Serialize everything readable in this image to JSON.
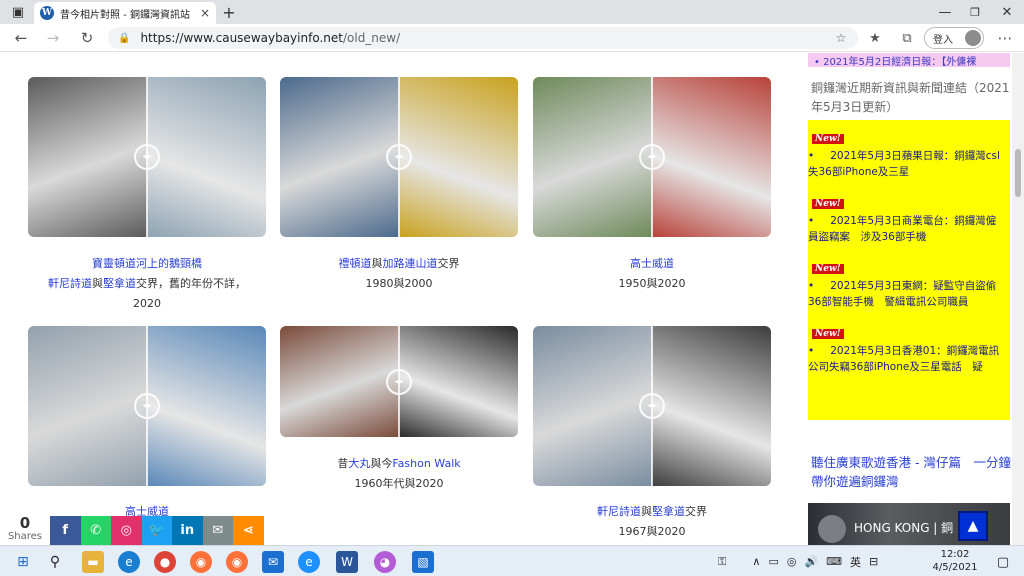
{
  "browser": {
    "tab_title": "昔今相片對照 - 銅鑼灣資訊站",
    "tab_close": "×",
    "new_tab": "+",
    "url_host": "https://www.causewaybayinfo.net",
    "url_path": "/old_new/",
    "login_label": "登入",
    "window_controls": [
      "—",
      "❐",
      "✕"
    ]
  },
  "sliders": [
    {
      "caption_lines": [
        [
          {
            "text": "寶靈頓道河上的鵝頸橋",
            "link": true
          }
        ],
        [
          {
            "text": "軒尼詩道",
            "link": true
          },
          {
            "text": "與",
            "link": false
          },
          {
            "text": "堅拿道",
            "link": true
          },
          {
            "text": "交界，舊的年份不詳，",
            "link": false
          }
        ],
        [
          {
            "text": "2020",
            "link": false
          }
        ]
      ],
      "old_color": "#5b5b5b",
      "new_color": "#8da3b3",
      "split": 0.5
    },
    {
      "caption_lines": [
        [
          {
            "text": "禮頓道",
            "link": true
          },
          {
            "text": "與",
            "link": false
          },
          {
            "text": "加路連山道",
            "link": true
          },
          {
            "text": "交界",
            "link": false
          }
        ],
        [
          {
            "text": "1980與2000",
            "link": false
          }
        ]
      ],
      "old_color": "#4c6a8c",
      "new_color": "#c9a21e",
      "split": 0.5
    },
    {
      "caption_lines": [
        [
          {
            "text": "高士威道",
            "link": true
          }
        ],
        [
          {
            "text": "1950與2020",
            "link": false
          }
        ]
      ],
      "old_color": "#6e8a5a",
      "new_color": "#b8423a",
      "split": 0.5
    },
    {
      "caption_lines": [
        [
          {
            "text": "高士威道",
            "link": true
          }
        ]
      ],
      "old_color": "#93a1ad",
      "new_color": "#5a88b8",
      "split": 0.5
    },
    {
      "caption_lines": [
        [
          {
            "text": "昔",
            "link": false
          },
          {
            "text": "大丸",
            "link": true
          },
          {
            "text": "與今",
            "link": false
          },
          {
            "text": "Fashon Walk",
            "link": true
          }
        ],
        [
          {
            "text": "1960年代與2020",
            "link": false
          }
        ]
      ],
      "old_color": "#7a4b3a",
      "new_color": "#2a2a2a",
      "split": 0.5
    },
    {
      "caption_lines": [
        [
          {
            "text": "軒尼詩道",
            "link": true
          },
          {
            "text": "與",
            "link": false
          },
          {
            "text": "堅拿道",
            "link": true
          },
          {
            "text": "交界",
            "link": false
          }
        ],
        [
          {
            "text": "1967與2020",
            "link": false
          }
        ]
      ],
      "old_color": "#7a8da0",
      "new_color": "#3d3d3d",
      "split": 0.5
    }
  ],
  "sidebar": {
    "pink_strip": "• 2021年5月2日經濟日報：【外傭裸",
    "news_heading": "銅鑼灣近期新資訊與新聞連結（2021年5月3日更新）",
    "new_badge": "New!",
    "news_items": [
      [
        "2021年5月3日蘋果日報：銅鑼灣csl",
        "失36部iPhone及三星"
      ],
      [
        "2021年5月3日商業電台：銅鑼灣僱",
        "員盜竊案　涉及36部手機"
      ],
      [
        "2021年5月3日東網：疑監守自盜偷",
        "36部智能手機　警緝電訊公司職員"
      ],
      [
        "2021年5月3日香港01：銅鑼灣電訊",
        "公司失竊36部iPhone及三星電話　疑"
      ]
    ],
    "song_link": "聽住廣東歌遊香港 - 灣仔篇　一分鐘帶你遊遍銅鑼灣",
    "video_title": "HONG KONG | 銅",
    "scroll_top": "▲"
  },
  "share": {
    "count": "0",
    "label": "Shares",
    "buttons": [
      {
        "name": "facebook-share-button",
        "glyph": "f",
        "color": "#3b5998"
      },
      {
        "name": "whatsapp-share-button",
        "glyph": "✆",
        "color": "#25d366"
      },
      {
        "name": "instagram-share-button",
        "glyph": "◎",
        "color": "#e1306c"
      },
      {
        "name": "twitter-share-button",
        "glyph": "🐦",
        "color": "#1da1f2"
      },
      {
        "name": "linkedin-share-button",
        "glyph": "in",
        "color": "#0077b5"
      },
      {
        "name": "email-share-button",
        "glyph": "✉",
        "color": "#7d8b8a"
      },
      {
        "name": "more-share-button",
        "glyph": "⋖",
        "color": "#ff8c00"
      }
    ]
  },
  "taskbar": {
    "ime": "英",
    "time": "12:02",
    "date": "4/5/2021"
  }
}
